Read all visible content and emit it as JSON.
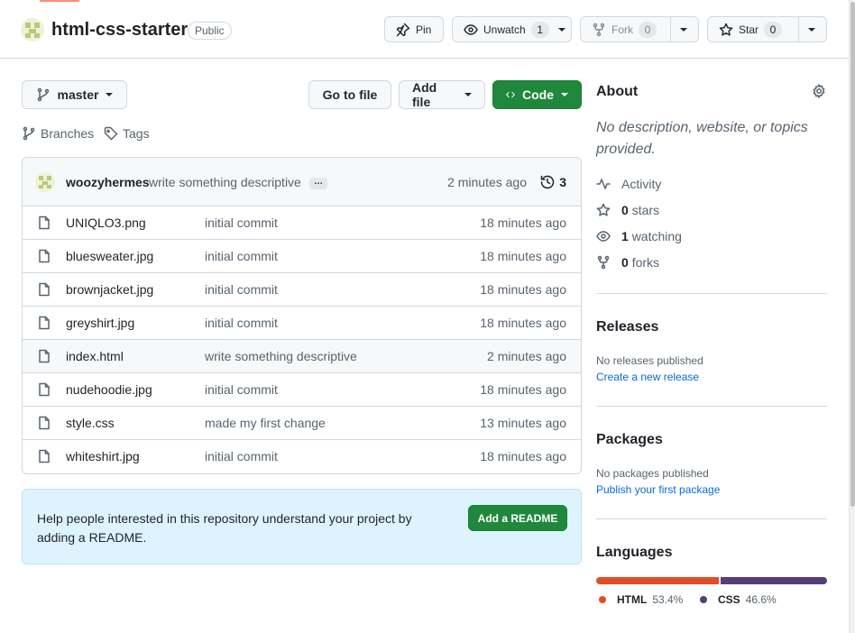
{
  "repo": {
    "name": "html-css-starter",
    "visibility": "Public",
    "pin_label": "Pin",
    "unwatch_label": "Unwatch",
    "watch_count": "1",
    "fork_label": "Fork",
    "fork_count": "0",
    "star_label": "Star",
    "star_count": "0"
  },
  "toolbar": {
    "branch": "master",
    "go_to_file": "Go to file",
    "add_file": "Add file",
    "code": "Code",
    "branches_link": "Branches",
    "tags_link": "Tags"
  },
  "latest_commit": {
    "author": "woozyhermes",
    "message": "write something descriptive",
    "ellipsis": "…",
    "time": "2 minutes ago",
    "commit_count": "3"
  },
  "files": [
    {
      "name": "UNIQLO3.png",
      "message": "initial commit",
      "time": "18 minutes ago"
    },
    {
      "name": "bluesweater.jpg",
      "message": "initial commit",
      "time": "18 minutes ago"
    },
    {
      "name": "brownjacket.jpg",
      "message": "initial commit",
      "time": "18 minutes ago"
    },
    {
      "name": "greyshirt.jpg",
      "message": "initial commit",
      "time": "18 minutes ago"
    },
    {
      "name": "index.html",
      "message": "write something descriptive",
      "time": "2 minutes ago"
    },
    {
      "name": "nudehoodie.jpg",
      "message": "initial commit",
      "time": "18 minutes ago"
    },
    {
      "name": "style.css",
      "message": "made my first change",
      "time": "13 minutes ago"
    },
    {
      "name": "whiteshirt.jpg",
      "message": "initial commit",
      "time": "18 minutes ago"
    }
  ],
  "readme_banner": {
    "text": "Help people interested in this repository understand your project by adding a README.",
    "button": "Add a README"
  },
  "about": {
    "title": "About",
    "description": "No description, website, or topics provided.",
    "activity": "Activity",
    "stars_count": "0",
    "stars_label": "stars",
    "watching_count": "1",
    "watching_label": "watching",
    "forks_count": "0",
    "forks_label": "forks"
  },
  "releases": {
    "title": "Releases",
    "empty": "No releases published",
    "link": "Create a new release"
  },
  "packages": {
    "title": "Packages",
    "empty": "No packages published",
    "link": "Publish your first package"
  },
  "languages": {
    "title": "Languages",
    "items": [
      {
        "name": "HTML",
        "percent": "53.4%",
        "value": 53.4,
        "color": "#e34c26"
      },
      {
        "name": "CSS",
        "percent": "46.6%",
        "value": 46.6,
        "color": "#563d7c"
      }
    ]
  },
  "colors": {
    "primary_green": "#1f883d",
    "link_blue": "#0969da",
    "banner_bg": "#ddf4ff"
  }
}
